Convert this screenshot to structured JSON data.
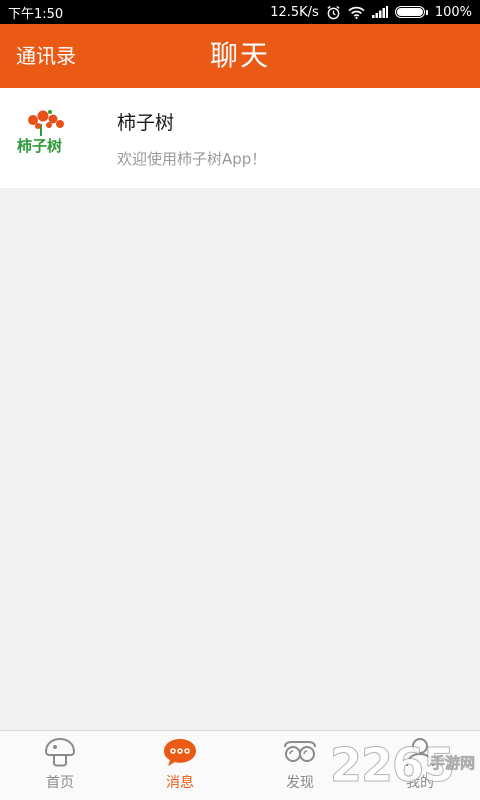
{
  "status_bar": {
    "time": "下午1:50",
    "network_speed": "12.5K/s",
    "battery_percent": "100%",
    "battery_level": 1.0,
    "icons": [
      "alarm-icon",
      "wifi-icon",
      "signal-icon",
      "battery-icon"
    ]
  },
  "header": {
    "left_label": "通讯录",
    "title": "聊天",
    "color": "#eb5a14"
  },
  "chats": [
    {
      "name": "柿子树",
      "preview": "欢迎使用柿子树App！",
      "avatar_text": "柿子树"
    }
  ],
  "tabs": [
    {
      "label": "首页",
      "icon": "mushroom-home-icon",
      "active": false
    },
    {
      "label": "消息",
      "icon": "chat-bubble-icon",
      "active": true
    },
    {
      "label": "发现",
      "icon": "goggles-discover-icon",
      "active": false
    },
    {
      "label": "我的",
      "icon": "person-icon",
      "active": false
    }
  ],
  "watermark": {
    "number": "2265",
    "text": "手游网"
  },
  "colors": {
    "accent": "#eb5a14",
    "background": "#f1f1f1",
    "avatar_green": "#2e9b3a"
  }
}
